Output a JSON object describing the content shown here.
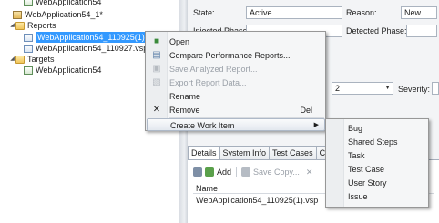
{
  "tree": {
    "items": [
      {
        "label": "WebApplication54",
        "icon": "project-icon"
      },
      {
        "label": "WebApplication54_1*",
        "icon": "solution-icon"
      },
      {
        "label": "Reports",
        "icon": "folder-icon"
      },
      {
        "label": "WebApplication54_110925(1).",
        "icon": "report-file-icon"
      },
      {
        "label": "WebApplication54_110927.vsp",
        "icon": "report-file-icon"
      },
      {
        "label": "Targets",
        "icon": "folder-icon"
      },
      {
        "label": "WebApplication54",
        "icon": "target-icon"
      }
    ]
  },
  "properties": {
    "state_label": "State:",
    "state_value": "Active",
    "reason_label": "Reason:",
    "reason_value": "New",
    "injected_label": "Injected Phase:",
    "detected_label": "Detected Phase:",
    "priority_value": "2",
    "severity_label": "Severity:"
  },
  "tabs": [
    "Details",
    "System Info",
    "Test Cases",
    "Caus"
  ],
  "attachments": {
    "add_label": "Add",
    "save_copy_label": "Save Copy...",
    "delete_glyph": "✕",
    "column_name": "Name",
    "rows": [
      "WebApplication54_110925(1).vsp"
    ]
  },
  "context_menu": {
    "items": [
      {
        "label": "Open",
        "icon": "open-icon",
        "enabled": true
      },
      {
        "label": "Compare Performance Reports...",
        "icon": "compare-icon",
        "enabled": true
      },
      {
        "label": "Save Analyzed Report...",
        "icon": "save-icon",
        "enabled": false
      },
      {
        "label": "Export Report Data...",
        "icon": "export-icon",
        "enabled": false
      },
      {
        "label": "Rename",
        "icon": "",
        "enabled": true
      },
      {
        "label": "Remove",
        "icon": "remove-icon",
        "enabled": true,
        "shortcut": "Del"
      },
      {
        "label": "Create Work Item",
        "icon": "",
        "enabled": true,
        "submenu": true
      }
    ]
  },
  "submenu": {
    "items": [
      "Bug",
      "Shared Steps",
      "Task",
      "Test Case",
      "User Story",
      "Issue"
    ]
  },
  "colors": {
    "selection": "#3399ff",
    "menu_bg": "#f5f6f7"
  }
}
